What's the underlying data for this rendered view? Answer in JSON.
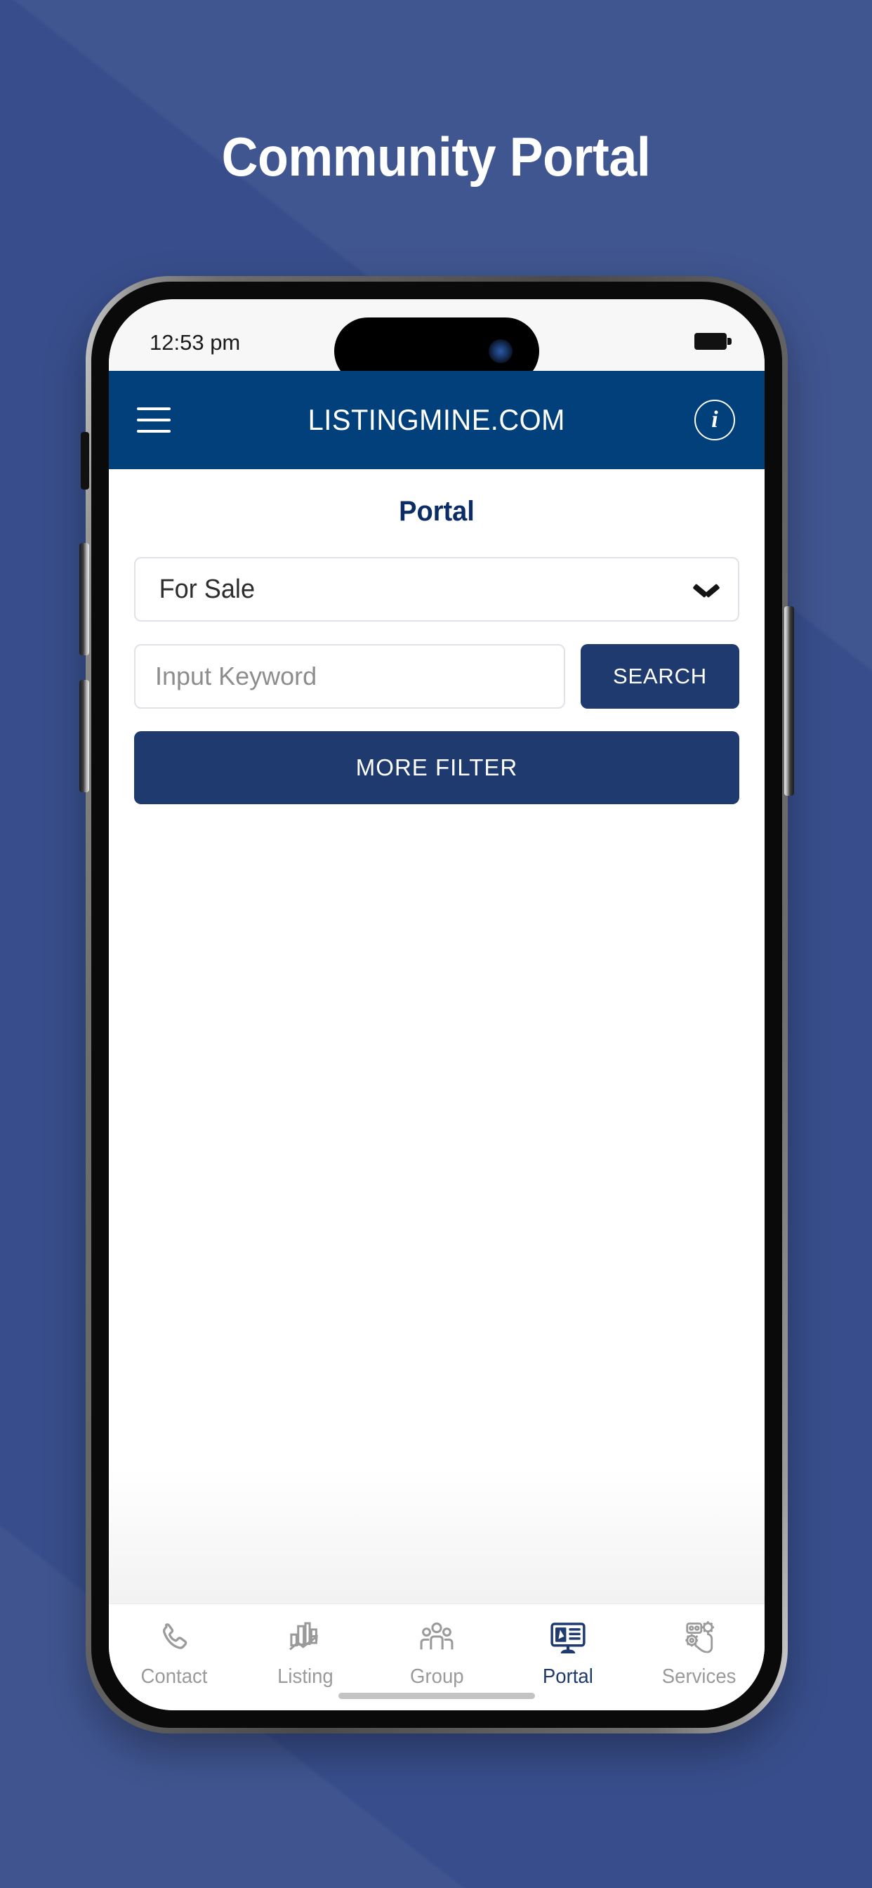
{
  "page": {
    "title": "Community Portal",
    "background_color": "#384e8c"
  },
  "phone": {
    "status_bar": {
      "time": "12:53 pm",
      "battery_icon": "battery-full-icon",
      "camera_icon": "front-camera-icon"
    }
  },
  "header": {
    "menu_icon": "hamburger-menu-icon",
    "title": "LISTINGMINE.COM",
    "info_icon": "info-icon",
    "info_label": "i",
    "background_color": "#01407a"
  },
  "main": {
    "section_title": "Portal",
    "filter_select": {
      "selected": "For Sale",
      "chevron_icon": "chevron-down-icon",
      "options": [
        "For Sale"
      ]
    },
    "search": {
      "placeholder": "Input Keyword",
      "value": "",
      "button_label": "SEARCH"
    },
    "more_filter_label": "MORE FILTER",
    "accent_color": "#1e3a6e"
  },
  "bottom_nav": {
    "active_index": 3,
    "items": [
      {
        "label": "Contact",
        "icon": "phone-icon",
        "active": false
      },
      {
        "label": "Listing",
        "icon": "buildings-chart-icon",
        "active": false
      },
      {
        "label": "Group",
        "icon": "people-group-icon",
        "active": false
      },
      {
        "label": "Portal",
        "icon": "presentation-board-icon",
        "active": true
      },
      {
        "label": "Services",
        "icon": "person-gears-icon",
        "active": false
      }
    ],
    "active_color": "#1e3a6e",
    "inactive_color": "#9a9a9a"
  }
}
